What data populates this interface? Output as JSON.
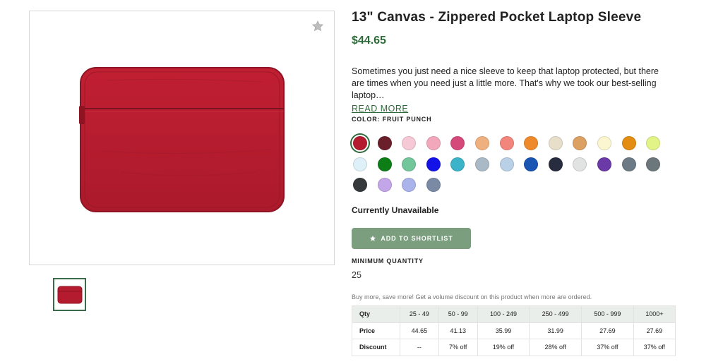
{
  "product": {
    "title": "13\" Canvas - Zippered Pocket Laptop Sleeve",
    "price": "$44.65",
    "description": "Sometimes you just need a nice sleeve to keep that laptop protected, but there are times when you need just a little more. That's why we took our best-selling laptop…",
    "read_more": "READ MORE",
    "image_icon": "favorite-star-icon"
  },
  "color": {
    "label": "COLOR: FRUIT PUNCH",
    "selected": "Fruit Punch",
    "swatches": [
      "#b51b2e",
      "#6b1f2b",
      "#f6c9d6",
      "#f2a8ba",
      "#d5497a",
      "#efb07f",
      "#f2857c",
      "#ee8a2c",
      "#e8dfcb",
      "#dca162",
      "#fbf6cf",
      "#e38d12",
      "#e2f387",
      "#dff1f8",
      "#0d7d16",
      "#72c69a",
      "#1313e8",
      "#3cb3c8",
      "#a9bac6",
      "#b9d0e6",
      "#1b55b4",
      "#272c3e",
      "#e1e3e2",
      "#6b3aa7",
      "#6b7a84",
      "#6b777b",
      "#36393b",
      "#c2a6e8",
      "#aab4ea",
      "#7a8aa4"
    ]
  },
  "availability": "Currently Unavailable",
  "shortlist_button": "ADD TO SHORTLIST",
  "minimum": {
    "label": "MINIMUM QUANTITY",
    "value": "25"
  },
  "volume_note": "Buy more, save more! Get a volume discount on this product when more are ordered.",
  "pricing_table": {
    "rows": [
      [
        "Qty",
        "25 - 49",
        "50 - 99",
        "100 - 249",
        "250 - 499",
        "500 - 999",
        "1000+"
      ],
      [
        "Price",
        "44.65",
        "41.13",
        "35.99",
        "31.99",
        "27.69",
        "27.69"
      ],
      [
        "Discount",
        "--",
        "7% off",
        "19% off",
        "28% off",
        "37% off",
        "37% off"
      ]
    ]
  },
  "colors": {
    "accent": "#2f6b3a",
    "button": "#7a9e7e",
    "sleeve": "#b51b2e"
  }
}
